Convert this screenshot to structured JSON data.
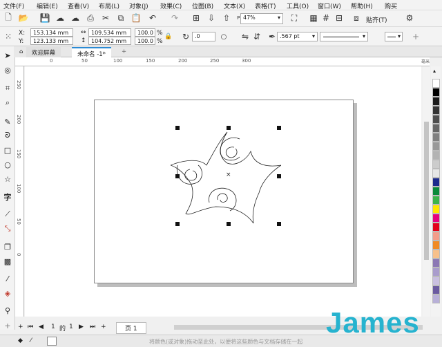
{
  "menubar": {
    "items": [
      "文件(F)",
      "编辑(E)",
      "查看(V)",
      "布局(L)",
      "对象(J)",
      "效果(C)",
      "位图(B)",
      "文本(X)",
      "表格(T)",
      "工具(O)",
      "窗口(W)",
      "帮助(H)",
      "购买"
    ]
  },
  "toolbar": {
    "zoom": "47%",
    "snap_label": "贴齐(T)"
  },
  "propbar": {
    "x_label": "X:",
    "x": "153.134 mm",
    "y_label": "Y:",
    "y": "123.133 mm",
    "w": "109.534 mm",
    "h": "104.752 mm",
    "sx": "100.0",
    "sy": "100.0",
    "pct": "%",
    "angle": ".0",
    "outline": ".567 pt"
  },
  "tabs": {
    "welcome": "欢迎屏幕",
    "doc": "未命名 -1*",
    "add": "+"
  },
  "ruler": {
    "h": [
      "0",
      "50",
      "100",
      "150",
      "200",
      "250",
      "300"
    ],
    "v": [
      "250",
      "200",
      "150",
      "100",
      "50",
      "0"
    ],
    "unit": "毫米"
  },
  "pagebar": {
    "current": "1",
    "of": "的",
    "total": "1",
    "page_tab": "页 1"
  },
  "status": {
    "hint": "将颜色(或对象)拖动至此处，以便将这些颜色与文档存储在一起"
  },
  "watermark": "James",
  "colors": {
    "accent": "#2a8ad4",
    "watermark": "#26b3cf",
    "selection_handle": "#111111"
  }
}
